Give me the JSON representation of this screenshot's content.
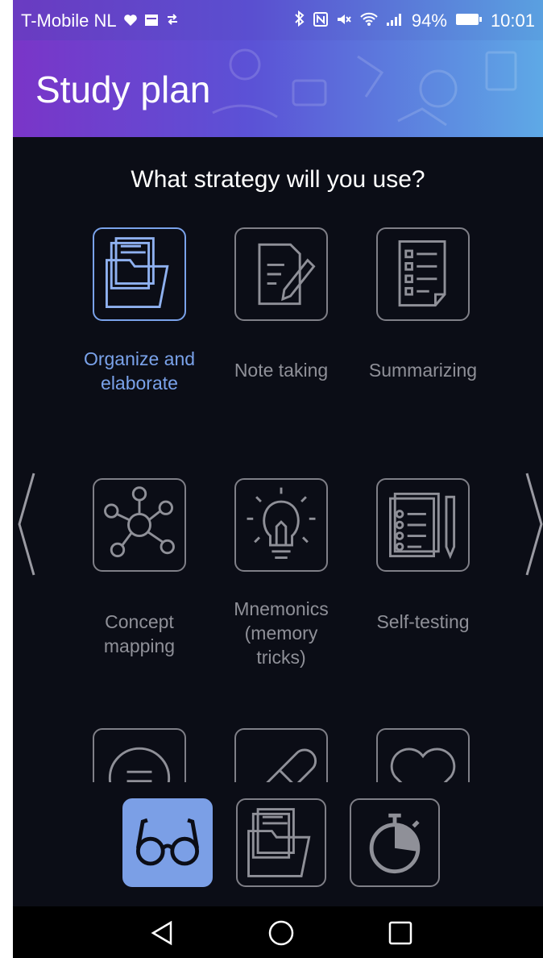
{
  "status_bar": {
    "carrier": "T-Mobile NL",
    "battery": "94%",
    "time": "10:01",
    "icons_left": [
      "heart-icon",
      "calendar-icon",
      "transfer-icon"
    ],
    "icons_right": [
      "bluetooth-icon",
      "nfc-icon",
      "mute-icon",
      "wifi-icon",
      "signal-icon",
      "battery-icon"
    ]
  },
  "header": {
    "title": "Study plan"
  },
  "main": {
    "question": "What strategy will you use?",
    "strategies": [
      {
        "label": "Organize and elaborate",
        "icon": "folder-documents-icon",
        "selected": true
      },
      {
        "label": "Note taking",
        "icon": "note-pencil-icon",
        "selected": false
      },
      {
        "label": "Summarizing",
        "icon": "checklist-document-icon",
        "selected": false
      },
      {
        "label": "Concept mapping",
        "icon": "concept-map-icon",
        "selected": false
      },
      {
        "label": "Mnemonics (memory tricks)",
        "icon": "lightbulb-icon",
        "selected": false
      },
      {
        "label": "Self-testing",
        "icon": "test-sheet-icon",
        "selected": false
      },
      {
        "label": "",
        "icon": "speech-bubble-icon",
        "selected": false
      },
      {
        "label": "",
        "icon": "pill-icon",
        "selected": false
      },
      {
        "label": "",
        "icon": "heart-outline-icon",
        "selected": false
      }
    ]
  },
  "bottom_tabs": [
    {
      "name": "glasses",
      "icon": "glasses-icon",
      "active": true
    },
    {
      "name": "folder",
      "icon": "folder-documents-icon",
      "active": false
    },
    {
      "name": "timer",
      "icon": "stopwatch-icon",
      "active": false
    }
  ],
  "colors": {
    "header_start": "#7a35c8",
    "header_end": "#5ea9e6",
    "accent": "#7b9fe6",
    "background": "#0b0d16"
  }
}
